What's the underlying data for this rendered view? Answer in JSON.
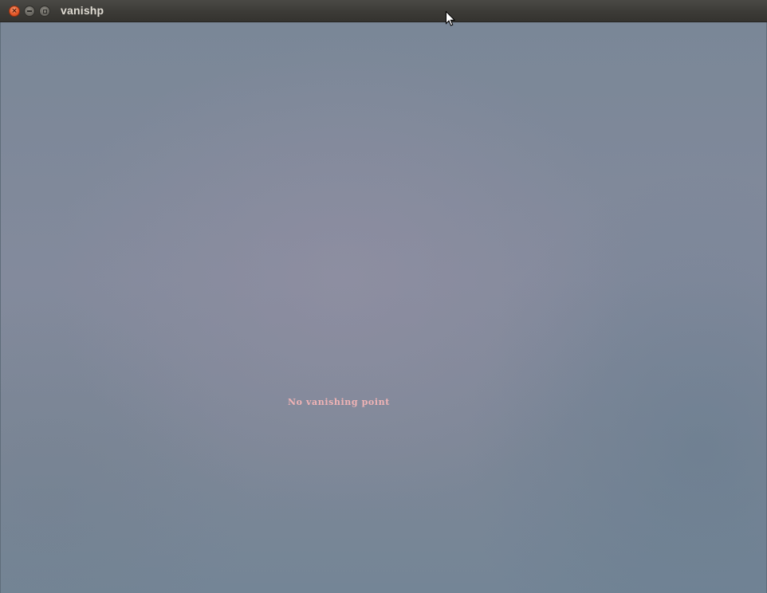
{
  "window": {
    "title": "vanishp",
    "buttons": {
      "close": "close-icon",
      "minimize": "minimize-icon",
      "maximize": "maximize-icon"
    }
  },
  "canvas": {
    "status_text": "No vanishing point",
    "status_color": "#f0b3b5"
  },
  "colors": {
    "titlebar": "#3c3b37",
    "close_button": "#e65a2a",
    "title_text": "#dfdbd2"
  }
}
